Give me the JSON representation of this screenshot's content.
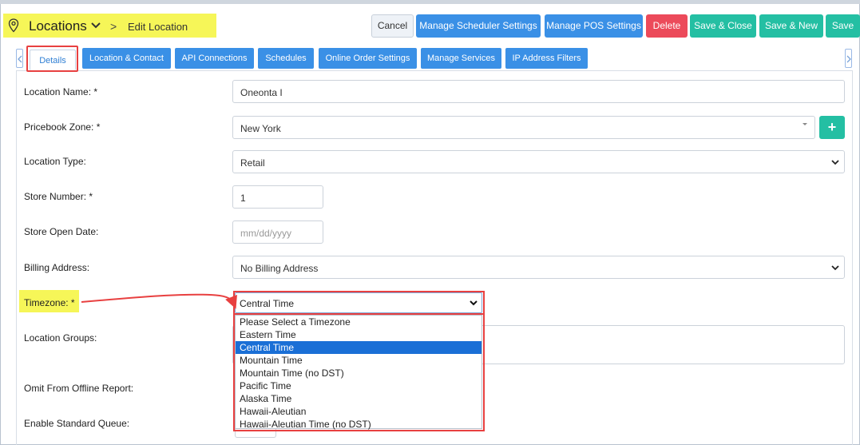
{
  "header": {
    "title": "Locations",
    "separator": ">",
    "subtitle": "Edit Location",
    "buttons": {
      "cancel": "Cancel",
      "manage_scheduler": "Manage Scheduler Settings",
      "manage_pos": "Manage POS Settings",
      "delete": "Delete",
      "save_close": "Save & Close",
      "save_new": "Save & New",
      "save": "Save"
    }
  },
  "tabs": [
    {
      "label": "Details",
      "active": true
    },
    {
      "label": "Location & Contact"
    },
    {
      "label": "API Connections"
    },
    {
      "label": "Schedules"
    },
    {
      "label": "Online Order Settings"
    },
    {
      "label": "Manage Services"
    },
    {
      "label": "IP Address Filters"
    }
  ],
  "form": {
    "location_name": {
      "label": "Location Name: *",
      "value": "Oneonta I"
    },
    "pricebook_zone": {
      "label": "Pricebook Zone: *",
      "value": "New York",
      "add_symbol": "+"
    },
    "location_type": {
      "label": "Location Type:",
      "value": "Retail"
    },
    "store_number": {
      "label": "Store Number: *",
      "value": "1"
    },
    "store_open_date": {
      "label": "Store Open Date:",
      "placeholder": "mm/dd/yyyy"
    },
    "billing_address": {
      "label": "Billing Address:",
      "value": "No Billing Address"
    },
    "timezone": {
      "label": "Timezone: *",
      "value": "Central Time",
      "options": [
        "Please Select a Timezone",
        "Eastern Time",
        "Central Time",
        "Mountain Time",
        "Mountain Time (no DST)",
        "Pacific Time",
        "Alaska Time",
        "Hawaii-Aleutian",
        "Hawaii-Aleutian Time (no DST)"
      ],
      "selected_index": 2
    },
    "location_groups": {
      "label": "Location Groups:"
    },
    "omit_offline": {
      "label": "Omit From Offline Report:"
    },
    "enable_queue": {
      "label": "Enable Standard Queue:"
    }
  },
  "colors": {
    "primary": "#3a90e6",
    "success": "#24bfa3",
    "danger": "#ec4a5a",
    "highlight": "#f6f658",
    "annotation": "#e84040"
  },
  "icons": {
    "location": "map-pin-icon",
    "dropdown": "chevron-down-icon",
    "tab_prev": "chevron-left-icon",
    "tab_next": "chevron-right-icon"
  }
}
